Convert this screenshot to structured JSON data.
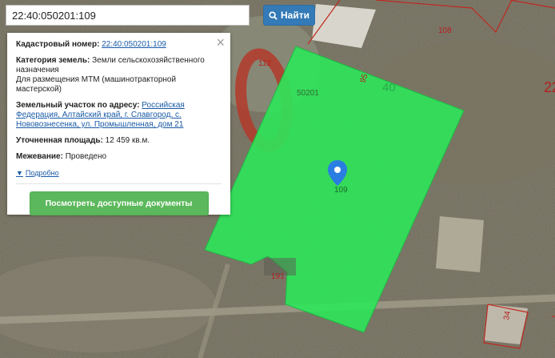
{
  "search": {
    "value": "22:40:050201:109",
    "button_label": "Найти",
    "icon": "search-icon"
  },
  "panel": {
    "cadastral_label": "Кадастровый номер:",
    "cadastral_value": "22:40:050201:109",
    "category_label": "Категория земель:",
    "category_value": "Земли сельскохозяйственного назначения",
    "usage": "Для размещения МТМ (машинотракторной мастерской)",
    "address_label": "Земельный участок по адресу:",
    "address_value": "Российская Федерация, Алтайский край, г. Славгород, с. Нововознесенка, ул. Промышленная, дом 21",
    "area_label": "Уточненная площадь:",
    "area_value": "12 459 кв.м.",
    "survey_label": "Межевание:",
    "survey_value": "Проведено",
    "details_label": "Подробно",
    "docs_button": "Посмотреть доступные документы",
    "close_icon": "close-icon"
  },
  "map": {
    "parcel_color": "#2ee65a",
    "boundary_color": "#c0281f",
    "labels": {
      "selected": "109",
      "block_suffix": "50201",
      "p40": "40",
      "p95": "95",
      "p108": "108",
      "p112": "112",
      "p191": "191",
      "p22": "22",
      "p34": "34"
    }
  }
}
